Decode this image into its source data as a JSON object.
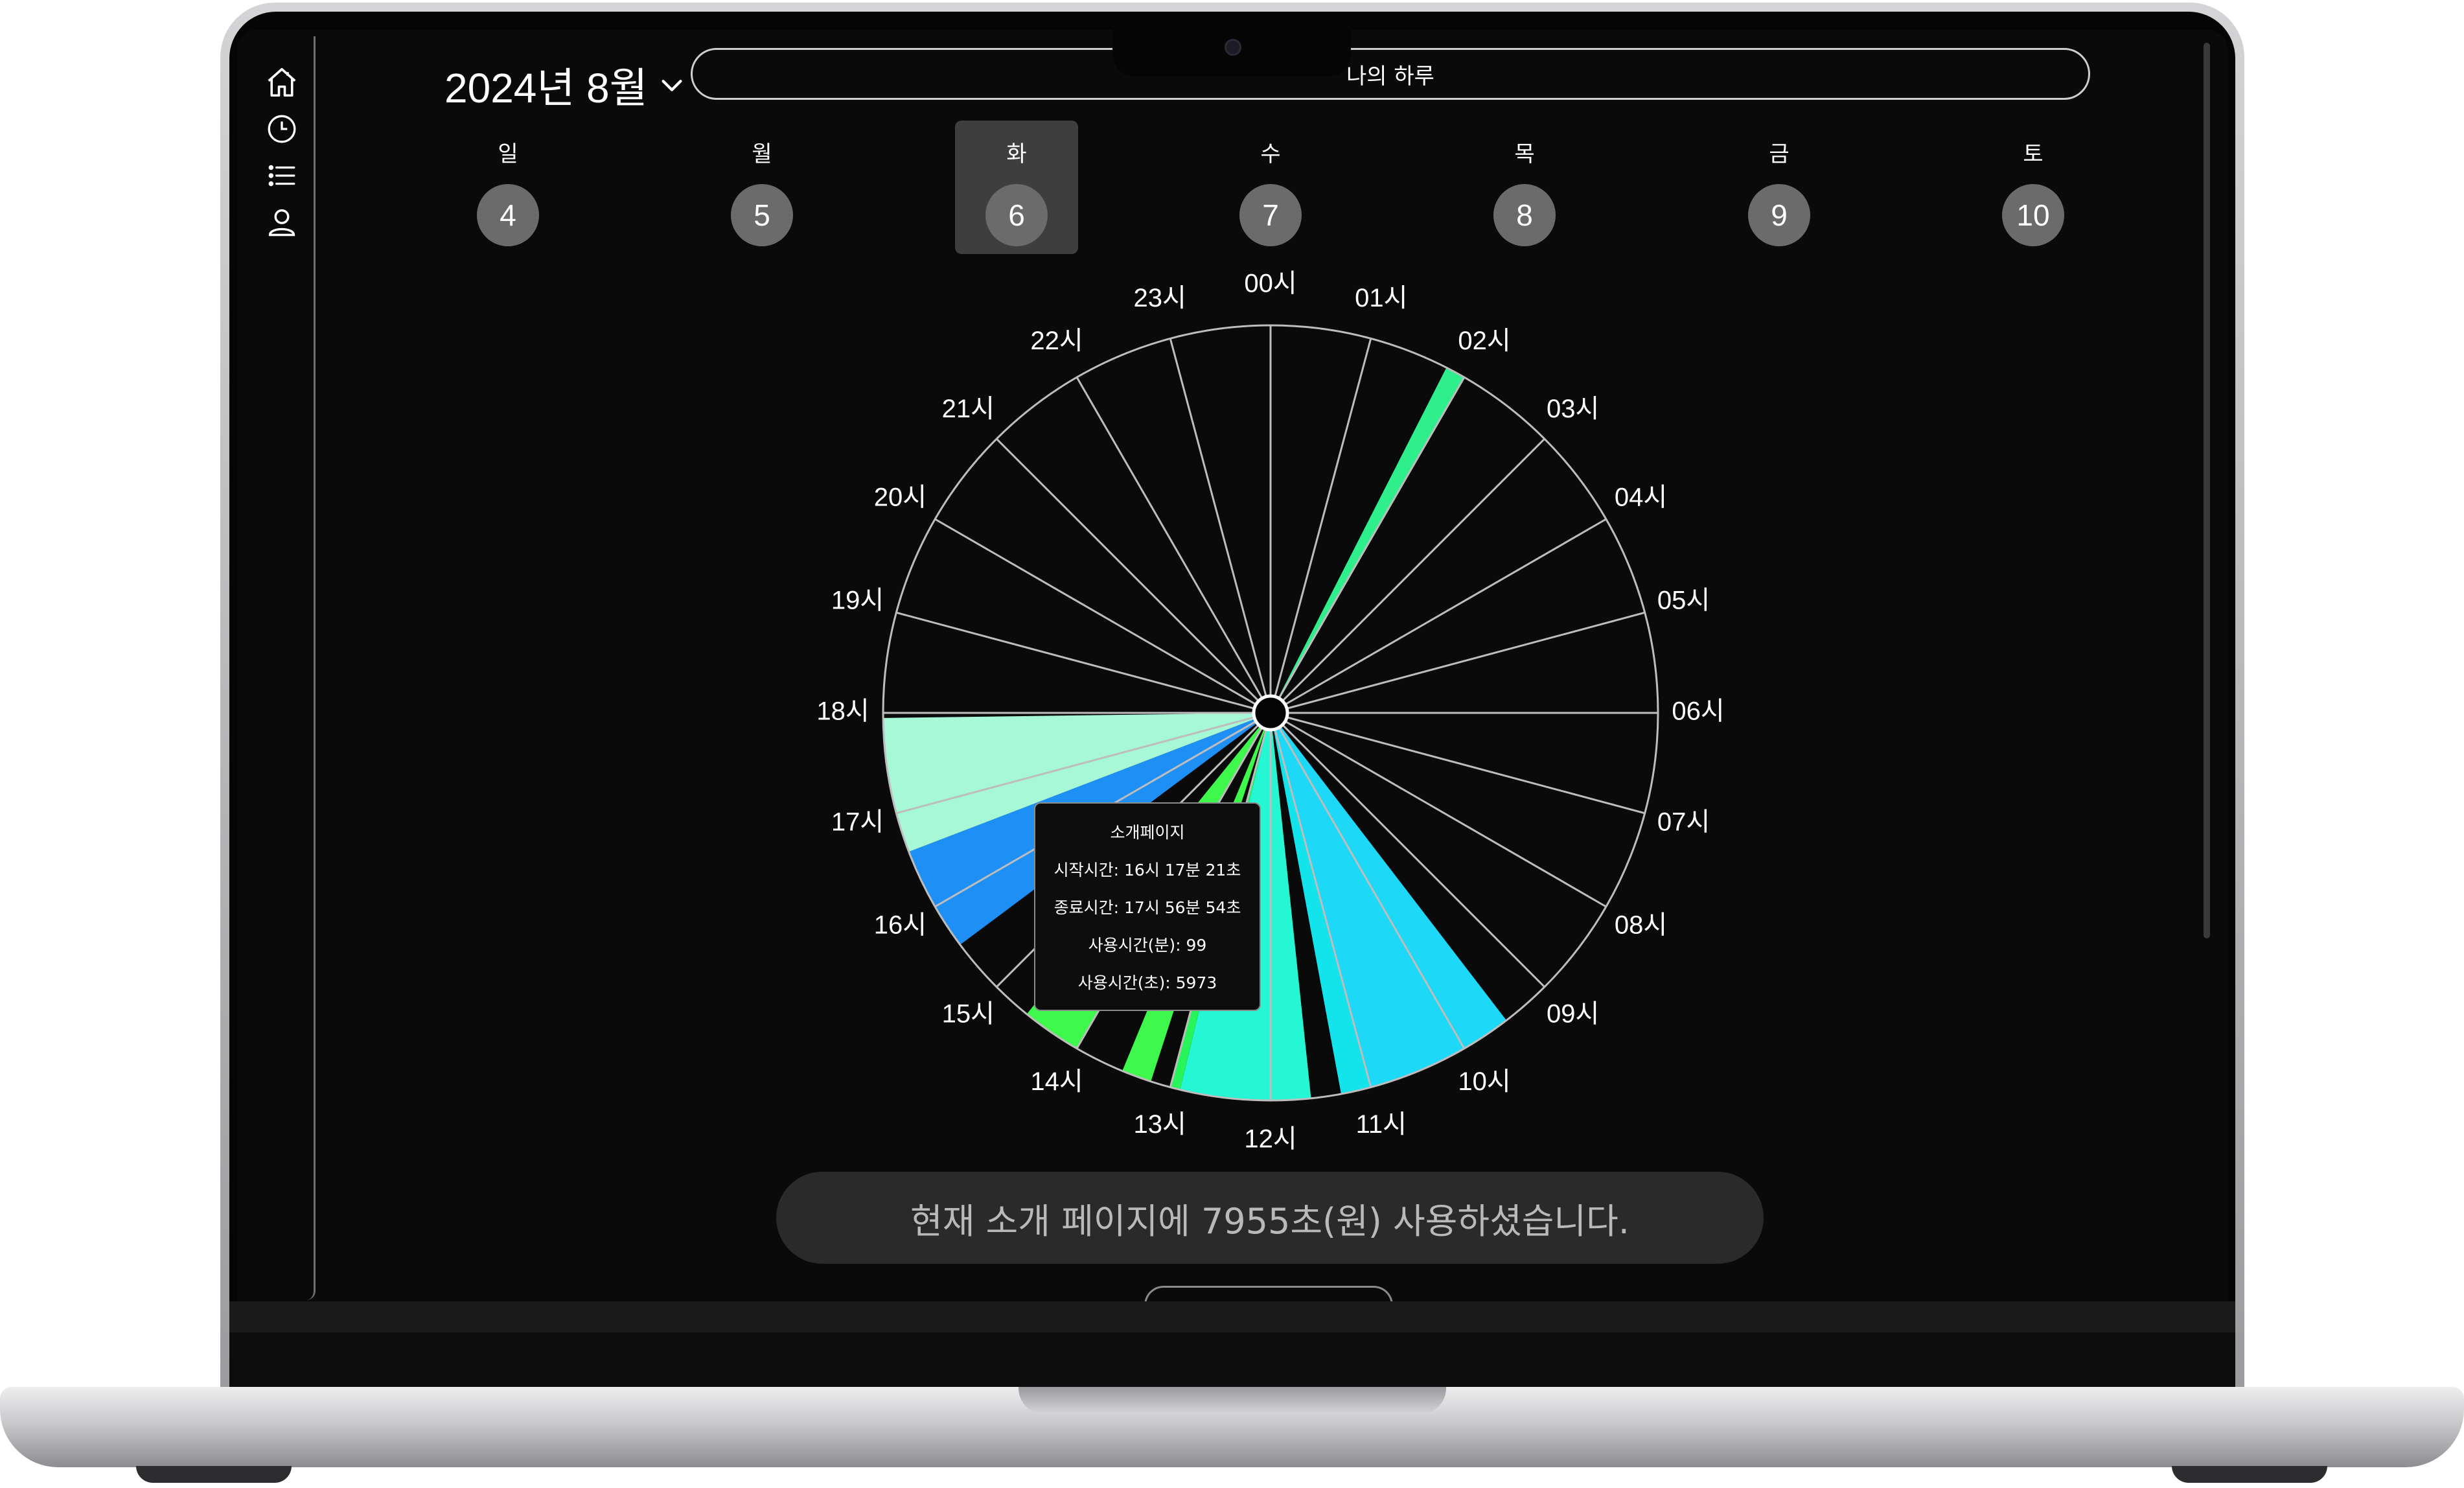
{
  "header": {
    "date_label": "2024년 8월",
    "title": "나의 하루"
  },
  "sidebar": {
    "items": [
      {
        "icon": "home-icon"
      },
      {
        "icon": "clock-icon"
      },
      {
        "icon": "list-icon"
      },
      {
        "icon": "user-icon"
      }
    ]
  },
  "week": {
    "days": [
      {
        "label": "일",
        "date": "4"
      },
      {
        "label": "월",
        "date": "5"
      },
      {
        "label": "화",
        "date": "6",
        "selected": true
      },
      {
        "label": "수",
        "date": "7"
      },
      {
        "label": "목",
        "date": "8"
      },
      {
        "label": "금",
        "date": "9"
      },
      {
        "label": "토",
        "date": "10"
      }
    ]
  },
  "chart_data": {
    "type": "pie",
    "hour_labels": [
      "00시",
      "01시",
      "02시",
      "03시",
      "04시",
      "05시",
      "06시",
      "07시",
      "08시",
      "09시",
      "10시",
      "11시",
      "12시",
      "13시",
      "14시",
      "15시",
      "16시",
      "17시",
      "18시"
    ],
    "hour_labels_rest": [
      "19시",
      "20시",
      "21시",
      "22시",
      "23시"
    ],
    "segments": [
      {
        "start_hour": 1.8,
        "end_hour": 2.0,
        "color": "#2fef8c"
      },
      {
        "start_hour": 9.5,
        "end_hour": 11.0,
        "color": "#1ed8f8"
      },
      {
        "start_hour": 11.0,
        "end_hour": 11.3,
        "color": "#13e3ea"
      },
      {
        "start_hour": 11.6,
        "end_hour": 12.9,
        "color": "#25f7d4"
      },
      {
        "start_hour": 12.9,
        "end_hour": 13.0,
        "color": "#28f55a"
      },
      {
        "start_hour": 13.2,
        "end_hour": 13.5,
        "color": "#3ef84b"
      },
      {
        "start_hour": 14.0,
        "end_hour": 14.6,
        "color": "#3ef84b"
      },
      {
        "start_hour": 15.55,
        "end_hour": 16.6,
        "color": "#1e90f5"
      },
      {
        "start_hour": 16.6,
        "end_hour": 17.95,
        "color": "#a6f8d6"
      }
    ]
  },
  "tooltip": {
    "title": "소개페이지",
    "start": "시작시간: 16시 17분 21초",
    "end": "종료시간: 17시 56분 54초",
    "minutes": "사용시간(분): 99",
    "seconds": "사용시간(초): 5973"
  },
  "summary": {
    "text": "현재 소개 페이지에 7955초(원) 사용하셨습니다."
  },
  "colors": {
    "background": "#0a0a0a",
    "selected_day": "#3e3e3e",
    "day_circle": "#6b6b6b",
    "summary_bg": "#2a2a2a"
  }
}
